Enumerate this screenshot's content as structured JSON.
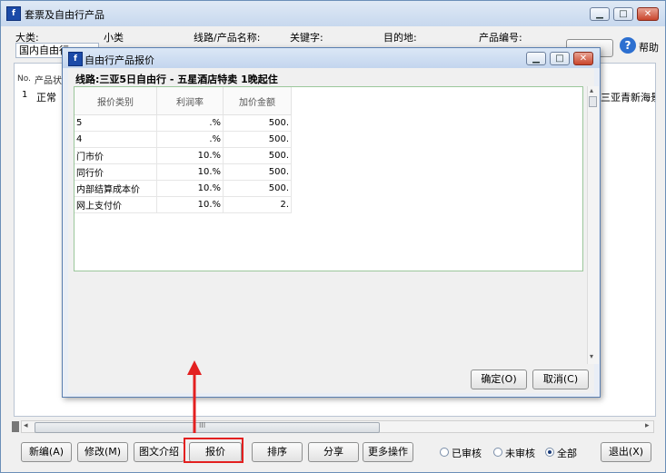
{
  "window": {
    "title": "套票及自由行产品",
    "help_label": "帮助",
    "icon": "app-icon"
  },
  "filters": {
    "category_label": "大类:",
    "category_value": "国内自由行",
    "subcategory_label": "小类",
    "route_label": "线路/产品名称:",
    "keyword_label": "关键字:",
    "destination_label": "目的地:",
    "product_code_label": "产品编号:"
  },
  "grid": {
    "col_no": "No.",
    "col_status": "产品状",
    "rows": [
      {
        "no": "1",
        "status": "正常",
        "tail": "三亚青新海景"
      }
    ]
  },
  "dialog": {
    "title": "自由行产品报价",
    "route_text": "线路:三亚5日自由行 - 五星酒店特卖 1晚起住",
    "columns": [
      "报价类别",
      "利润率",
      "加价金额"
    ],
    "rows": [
      {
        "type": "5",
        "rate": ".%",
        "amount": "500."
      },
      {
        "type": "4",
        "rate": ".%",
        "amount": "500."
      },
      {
        "type": "门市价",
        "rate": "10.%",
        "amount": "500."
      },
      {
        "type": "同行价",
        "rate": "10.%",
        "amount": "500."
      },
      {
        "type": "内部结算成本价",
        "rate": "10.%",
        "amount": "500."
      },
      {
        "type": "网上支付价",
        "rate": "10.%",
        "amount": "2."
      }
    ],
    "ok_label": "确定(O)",
    "cancel_label": "取消(C)"
  },
  "toolbar": {
    "new_label": "新编(A)",
    "edit_label": "修改(M)",
    "intro_label": "图文介绍",
    "quote_label": "报价",
    "sort_label": "排序",
    "share_label": "分享",
    "more_label": "更多操作",
    "exit_label": "退出(X)",
    "filter_reviewed": "已审核",
    "filter_unreviewed": "未审核",
    "filter_all": "全部",
    "selected_filter": "全部"
  },
  "scroll": {
    "h_grip": "III"
  },
  "colors": {
    "highlight": "#e32020",
    "accent": "#1b4aa8"
  }
}
